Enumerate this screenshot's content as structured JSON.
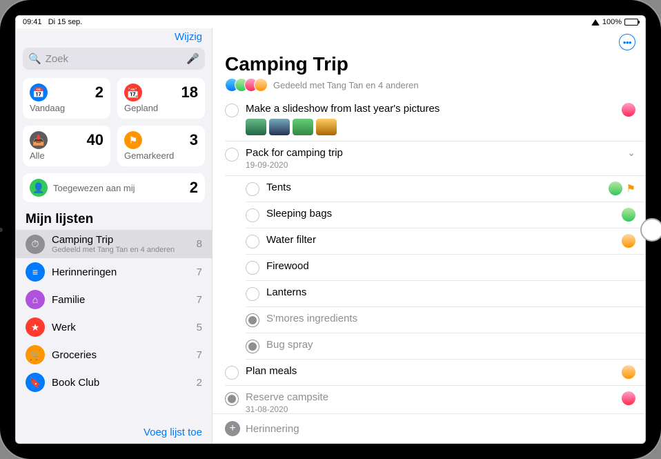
{
  "status": {
    "time": "09:41",
    "date": "Di 15 sep.",
    "battery": "100%"
  },
  "sidebar": {
    "edit": "Wijzig",
    "search_placeholder": "Zoek",
    "cards": {
      "today": {
        "label": "Vandaag",
        "count": "2"
      },
      "scheduled": {
        "label": "Gepland",
        "count": "18"
      },
      "all": {
        "label": "Alle",
        "count": "40"
      },
      "flagged": {
        "label": "Gemarkeerd",
        "count": "3"
      },
      "assigned": {
        "label": "Toegewezen aan mij",
        "count": "2"
      }
    },
    "lists_header": "Mijn lijsten",
    "lists": [
      {
        "name": "Camping Trip",
        "sub": "Gedeeld met Tang Tan en 4 anderen",
        "count": "8",
        "color": "#8e8e93",
        "icon": "⏱"
      },
      {
        "name": "Herinneringen",
        "sub": "",
        "count": "7",
        "color": "#007aff",
        "icon": "≡"
      },
      {
        "name": "Familie",
        "sub": "",
        "count": "7",
        "color": "#af52de",
        "icon": "⌂"
      },
      {
        "name": "Werk",
        "sub": "",
        "count": "5",
        "color": "#ff3b30",
        "icon": "★"
      },
      {
        "name": "Groceries",
        "sub": "",
        "count": "7",
        "color": "#ff9500",
        "icon": "🛒"
      },
      {
        "name": "Book Club",
        "sub": "",
        "count": "2",
        "color": "#007aff",
        "icon": "🔖"
      }
    ],
    "add_list": "Voeg lijst toe"
  },
  "main": {
    "title": "Camping Trip",
    "shared_label": "Gedeeld met Tang Tan en 4 anderen",
    "reminders": [
      {
        "title": "Make a slideshow from last year's pictures",
        "date": "",
        "done": false,
        "sub": false,
        "has_thumbs": true,
        "assignee": "av-pink",
        "flagged": false,
        "expandable": false
      },
      {
        "title": "Pack for camping trip",
        "date": "19-09-2020",
        "done": false,
        "sub": false,
        "has_thumbs": false,
        "assignee": "",
        "flagged": false,
        "expandable": true
      },
      {
        "title": "Tents",
        "date": "",
        "done": false,
        "sub": true,
        "has_thumbs": false,
        "assignee": "av-green",
        "flagged": true,
        "expandable": false
      },
      {
        "title": "Sleeping bags",
        "date": "",
        "done": false,
        "sub": true,
        "has_thumbs": false,
        "assignee": "av-green",
        "flagged": false,
        "expandable": false
      },
      {
        "title": "Water filter",
        "date": "",
        "done": false,
        "sub": true,
        "has_thumbs": false,
        "assignee": "av-orange",
        "flagged": false,
        "expandable": false
      },
      {
        "title": "Firewood",
        "date": "",
        "done": false,
        "sub": true,
        "has_thumbs": false,
        "assignee": "",
        "flagged": false,
        "expandable": false
      },
      {
        "title": "Lanterns",
        "date": "",
        "done": false,
        "sub": true,
        "has_thumbs": false,
        "assignee": "",
        "flagged": false,
        "expandable": false
      },
      {
        "title": "S'mores ingredients",
        "date": "",
        "done": true,
        "sub": true,
        "has_thumbs": false,
        "assignee": "",
        "flagged": false,
        "expandable": false
      },
      {
        "title": "Bug spray",
        "date": "",
        "done": true,
        "sub": true,
        "has_thumbs": false,
        "assignee": "",
        "flagged": false,
        "expandable": false
      },
      {
        "title": "Plan meals",
        "date": "",
        "done": false,
        "sub": false,
        "has_thumbs": false,
        "assignee": "av-orange",
        "flagged": false,
        "expandable": false
      },
      {
        "title": "Reserve campsite",
        "date": "31-08-2020",
        "done": true,
        "sub": false,
        "has_thumbs": false,
        "assignee": "av-pink",
        "flagged": false,
        "expandable": false
      }
    ],
    "new_reminder": "Herinnering"
  }
}
